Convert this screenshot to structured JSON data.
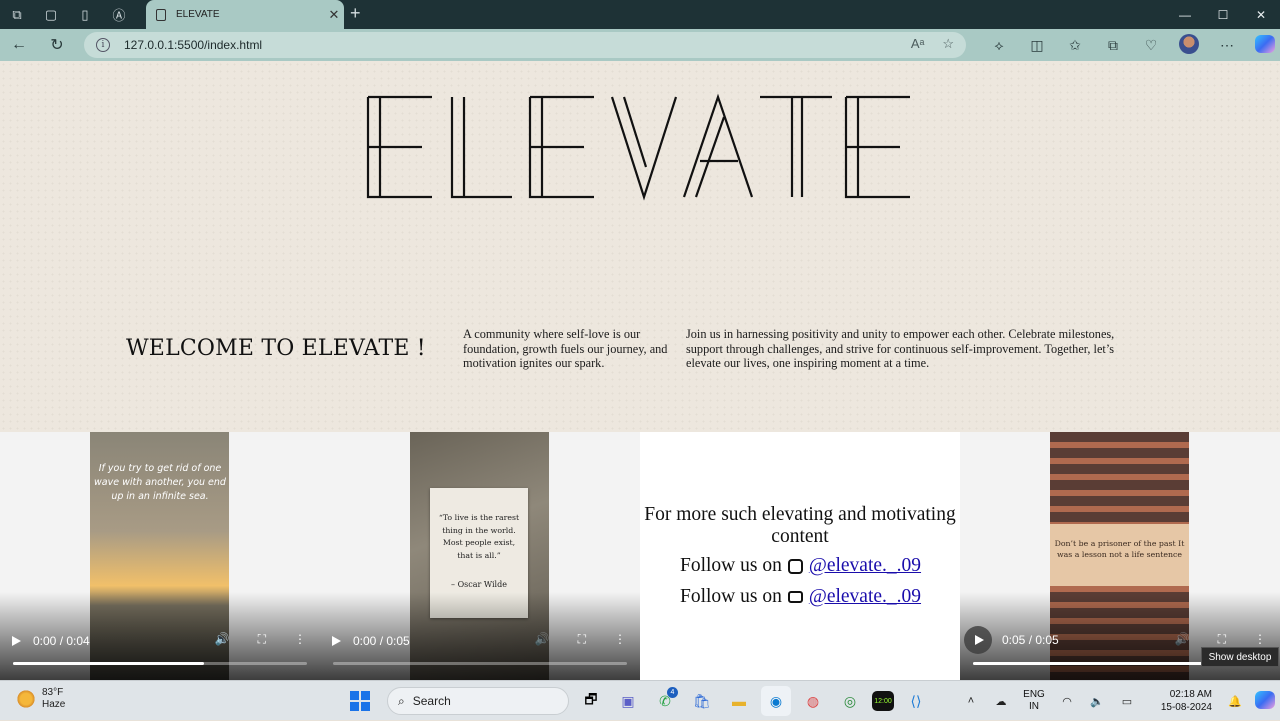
{
  "browser": {
    "tab_title": "ELEVATE",
    "url": "127.0.0.1:5500/index.html",
    "new_tab": "+",
    "window_controls": [
      "—",
      "☐",
      "✕"
    ]
  },
  "page": {
    "brand": "ELEVATE",
    "welcome_heading": "WELCOME TO ELEVATE !",
    "intro": "A community where self-love is our foundation, growth fuels our journey, and motivation ignites our spark.",
    "mission": "Join us in harnessing positivity and unity to empower each other. Celebrate milestones, support through challenges, and strive for continuous self-improvement. Together, let’s elevate our lives, one inspiring moment at a time."
  },
  "videos": [
    {
      "quote": "If you try to get rid of one wave with another, you end up in an infinite sea.",
      "time": "0:00 / 0:04",
      "progress": 0.65
    },
    {
      "quote": "“To live is the rarest thing in the world. Most people exist, that is all.”",
      "attribution": "– Oscar Wilde",
      "time": "0:00 / 0:05",
      "progress": 0.0
    },
    {
      "quote": "Don’t be a prisoner of the past It was a lesson not a life sentence",
      "time": "0:05 / 0:05",
      "progress": 1.0
    }
  ],
  "follow": {
    "heading": "For more such elevating and motivating content",
    "instagram_prefix": "Follow us on",
    "instagram_handle": "@elevate._.09",
    "youtube_prefix": "Follow us on",
    "youtube_handle": "@elevate._.09"
  },
  "tooltip": "Show desktop",
  "taskbar": {
    "temp": "83°F",
    "condition": "Haze",
    "search_label": "Search",
    "whatsapp_badge": "4",
    "clock_app_text": "12:00",
    "lang_line1": "ENG",
    "lang_line2": "IN",
    "time": "02:18 AM",
    "date": "15-08-2024"
  },
  "colors": {
    "page_background": "#ede7de",
    "tab_active": "#a9c9c4",
    "link": "#1a0dab"
  }
}
